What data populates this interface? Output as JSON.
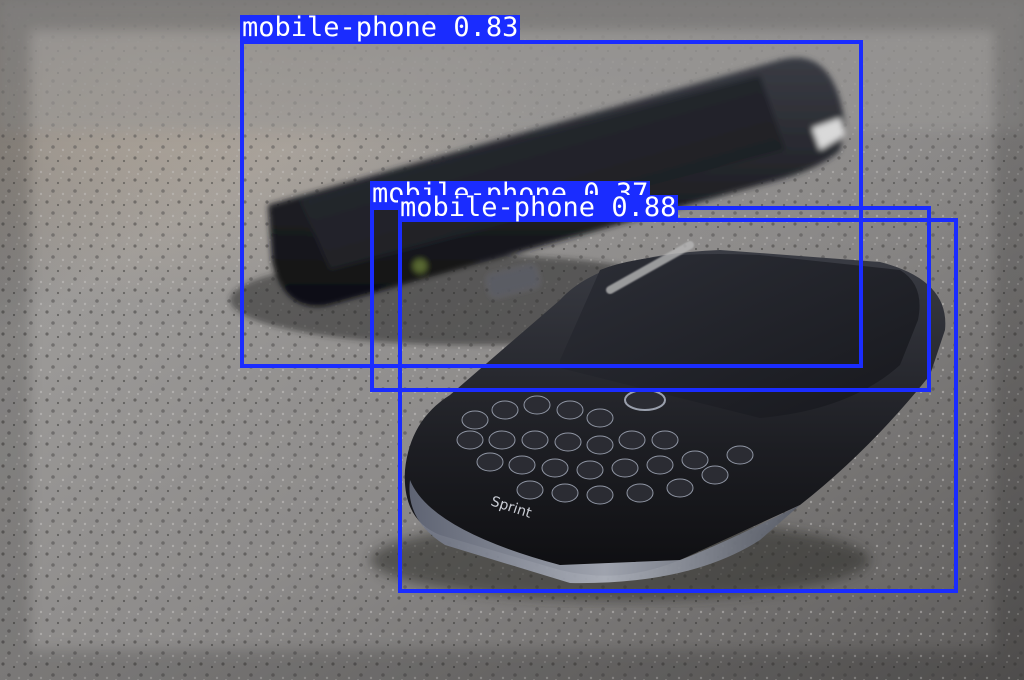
{
  "colors": {
    "box": "#1a2cff",
    "label_text": "#ffffff"
  },
  "detections": [
    {
      "label": "mobile-phone 0.88",
      "class": "mobile-phone",
      "confidence": 0.88
    },
    {
      "label": "mobile-phone 0.37",
      "class": "mobile-phone",
      "confidence": 0.37
    },
    {
      "label": "mobile-phone 0.83",
      "class": "mobile-phone",
      "confidence": 0.83
    }
  ],
  "phone_brand_text": "Sprint"
}
